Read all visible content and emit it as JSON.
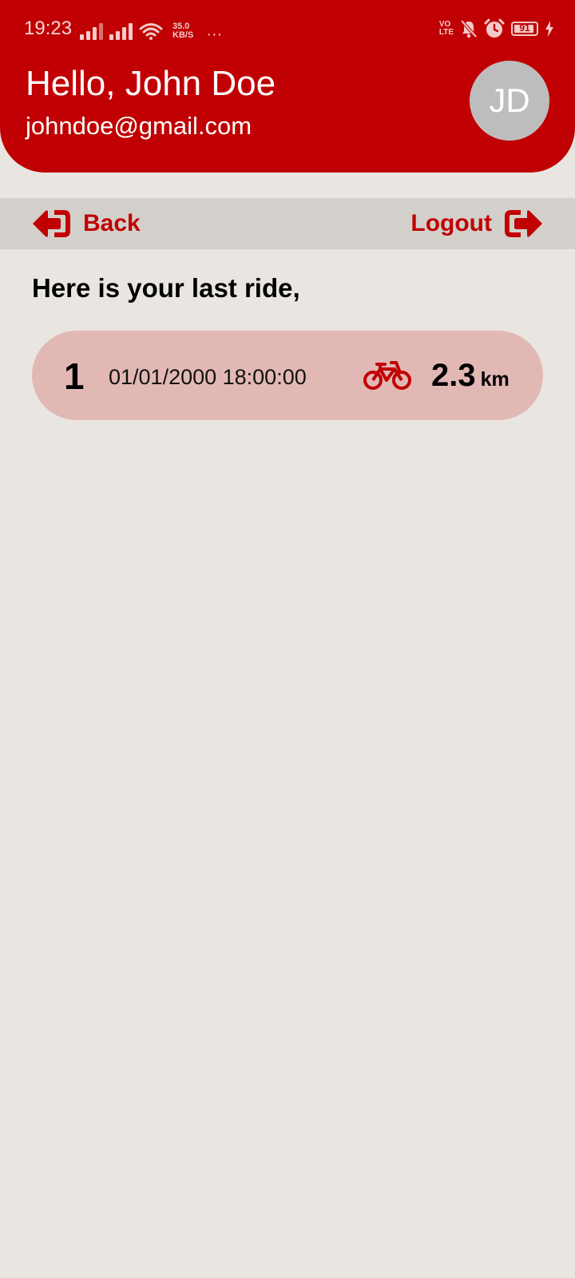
{
  "status_bar": {
    "time": "19:23",
    "network_speed_value": "35.0",
    "network_speed_unit": "KB/S",
    "volte_top": "VO",
    "volte_bottom": "LTE",
    "battery_level": "91",
    "battery_fraction": 0.91
  },
  "header": {
    "greeting": "Hello, John Doe",
    "email": "johndoe@gmail.com",
    "avatar_initials": "JD",
    "background_color": "#c00002"
  },
  "nav": {
    "back_label": "Back",
    "logout_label": "Logout",
    "accent_color": "#c10004"
  },
  "main": {
    "section_title": "Here is your last ride,",
    "rides": [
      {
        "index": "1",
        "datetime": "01/01/2000 18:00:00",
        "icon": "bicycle-icon",
        "distance": "2.3",
        "unit": "km"
      }
    ]
  }
}
